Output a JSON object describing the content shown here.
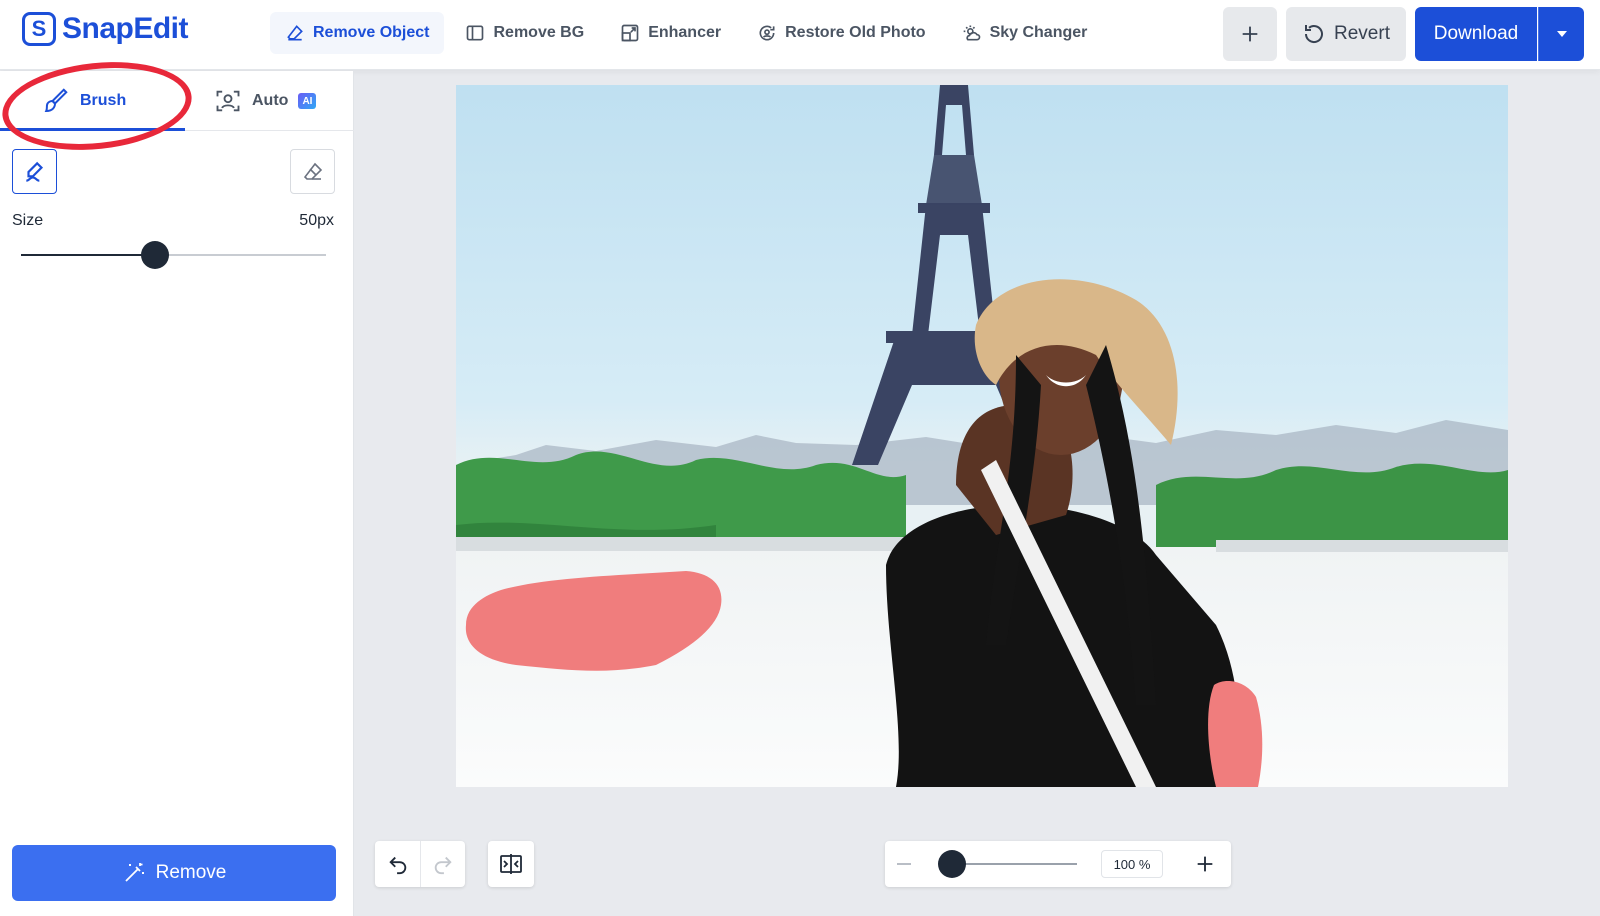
{
  "app": {
    "name": "SnapEdit",
    "logo_letter": "S"
  },
  "nav": [
    {
      "label": "Remove Object",
      "icon": "eraser-icon",
      "active": true
    },
    {
      "label": "Remove BG",
      "icon": "layers-icon",
      "active": false
    },
    {
      "label": "Enhancer",
      "icon": "expand-image-icon",
      "active": false
    },
    {
      "label": "Restore Old Photo",
      "icon": "face-restore-icon",
      "active": false
    },
    {
      "label": "Sky Changer",
      "icon": "sun-cloud-icon",
      "active": false
    }
  ],
  "actions": {
    "revert_label": "Revert",
    "download_label": "Download"
  },
  "sidebar": {
    "tabs": [
      {
        "label": "Brush",
        "icon": "brush-icon",
        "active": true
      },
      {
        "label": "Auto",
        "icon": "face-scan-icon",
        "badge": "AI",
        "active": false
      }
    ],
    "size_label": "Size",
    "size_value": "50px",
    "size_fraction": 0.44,
    "remove_label": "Remove"
  },
  "zoom": {
    "value": "100 %",
    "fraction": 0.0
  },
  "colors": {
    "brand": "#1c4fd8",
    "remove_button": "#3b6ff0",
    "brush_mask": "#f07d7d",
    "annotation_circle": "#e8283a"
  }
}
